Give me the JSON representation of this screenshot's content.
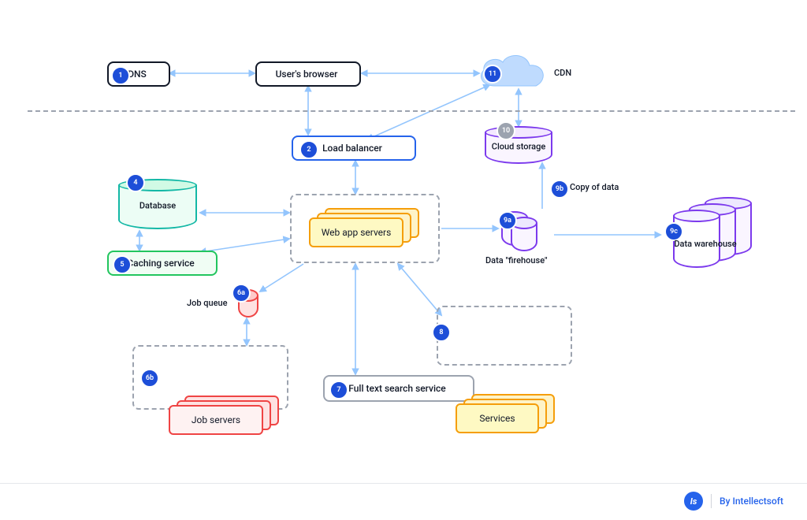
{
  "nodes": {
    "dns": {
      "badge": "1",
      "label": "DNS"
    },
    "browser": {
      "label": "User's browser"
    },
    "cdn": {
      "badge": "11",
      "label": "CDN"
    },
    "load_balancer": {
      "badge": "2",
      "label": "Load balancer"
    },
    "cloud_storage": {
      "badge": "10",
      "label": "Cloud storage"
    },
    "database": {
      "badge": "4",
      "label": "Database"
    },
    "caching": {
      "badge": "5",
      "label": "Caching service"
    },
    "web_servers": {
      "label": "Web app servers"
    },
    "job_queue": {
      "badge": "6a",
      "label": "Job queue"
    },
    "job_servers": {
      "badge": "6b",
      "label": "Job servers"
    },
    "search": {
      "badge": "7",
      "label": "Full text search service"
    },
    "services": {
      "badge": "8",
      "label": "Services"
    },
    "firehouse": {
      "badge": "9a",
      "label": "Data \"firehouse\""
    },
    "copy_of_data": {
      "badge": "9b",
      "label": "Copy of data"
    },
    "warehouse": {
      "badge": "9c",
      "label": "Data warehouse"
    }
  },
  "footer": {
    "logo_glyph": "Is",
    "credit": "By Intellectsoft"
  },
  "colors": {
    "arrow": "#93c5fd",
    "badge": "#1d4ed8",
    "badge_gray": "#9ca3af",
    "dashed": "#9ca3af",
    "orange": "#f59e0b",
    "green": "#22c55e",
    "red": "#ef4444",
    "purple": "#7c3aed",
    "teal": "#14b8a6"
  }
}
